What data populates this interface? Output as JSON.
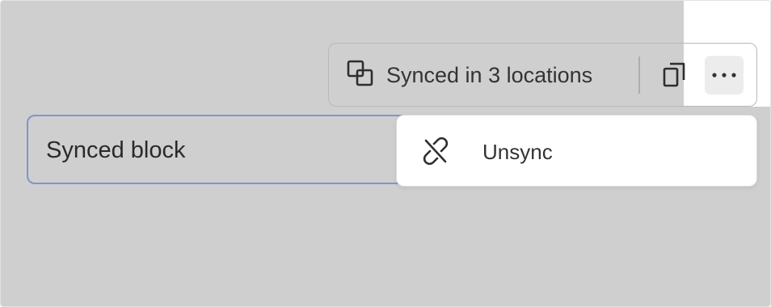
{
  "synced_block": {
    "label": "Synced block"
  },
  "toolbar": {
    "sync_status_label": "Synced in 3 locations",
    "sync_icon": "sync-icon",
    "copy_icon": "copy-icon",
    "more_icon": "more-icon"
  },
  "menu": {
    "items": [
      {
        "label": "Unsync",
        "icon": "unlink-icon"
      }
    ]
  },
  "colors": {
    "overlay": "#cfcfcf",
    "focus_border": "#8392cf",
    "text": "#333333"
  }
}
